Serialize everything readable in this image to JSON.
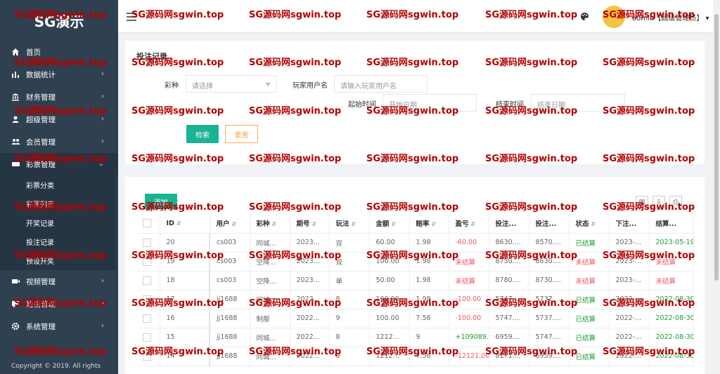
{
  "app": {
    "title": "SG演示"
  },
  "sidebar": {
    "items": [
      {
        "label": "首页",
        "icon": "home-icon"
      },
      {
        "label": "数据统计",
        "icon": "bar-chart-icon"
      },
      {
        "label": "财务管理",
        "icon": "bank-icon"
      },
      {
        "label": "超级管理",
        "icon": "user-shield-icon"
      },
      {
        "label": "会员管理",
        "icon": "users-icon"
      },
      {
        "label": "彩票管理",
        "icon": "lottery-icon"
      }
    ],
    "sub_items": [
      "彩票分类",
      "彩票列表",
      "开奖记录",
      "投注记录",
      "预设开奖"
    ],
    "items_after": [
      {
        "label": "视频管理",
        "icon": "video-icon"
      },
      {
        "label": "短信管理",
        "icon": "message-icon"
      },
      {
        "label": "系统管理",
        "icon": "gear-icon"
      }
    ],
    "copyright": "Copyright © 2019. All rights"
  },
  "header": {
    "user": "admin【超级管理员】"
  },
  "search": {
    "title": "投注记录",
    "lottery_label": "彩种",
    "lottery_placeholder": "请选择",
    "username_label": "玩家用户名",
    "username_placeholder": "请输入玩家用户名",
    "start_label": "起始时间",
    "start_placeholder": "开始日期",
    "end_label": "结束时间",
    "end_placeholder": "结束日期",
    "search_button": "检索",
    "reset_button": "重置"
  },
  "table": {
    "add_button": "添加",
    "columns": [
      "",
      "ID",
      "用户",
      "彩种",
      "期号",
      "玩法",
      "金额",
      "赔率",
      "盈亏",
      "投注...",
      "投注...",
      "状态",
      "下注...",
      "结算..."
    ],
    "rows": [
      {
        "id": "20",
        "user": "cs003",
        "lottery": "同城...",
        "issue": "2023...",
        "play": "双",
        "amount": "60.00",
        "odds": "1.98",
        "profit": "-60.00",
        "profit_color": "red",
        "b1": "8630....",
        "b2": "8570....",
        "status": "已结算",
        "status_color": "green",
        "bet_time": "2023-...",
        "settle_time": "2023-05-19",
        "settle_color": "green"
      },
      {
        "id": "19",
        "user": "cs003",
        "lottery": "空降...",
        "issue": "2023...",
        "play": "双",
        "amount": "100.00",
        "odds": "1.98",
        "profit": "未结算",
        "profit_color": "red",
        "b1": "8730....",
        "b2": "8630....",
        "status": "未结算",
        "status_color": "red",
        "bet_time": "2023-...",
        "settle_time": "未结算",
        "settle_color": "red"
      },
      {
        "id": "18",
        "user": "cs003",
        "lottery": "空降...",
        "issue": "2023...",
        "play": "单",
        "amount": "50.00",
        "odds": "1.98",
        "profit": "未结算",
        "profit_color": "red",
        "b1": "8780....",
        "b2": "8730....",
        "status": "未结算",
        "status_color": "red",
        "bet_time": "2023-...",
        "settle_time": "未结算",
        "settle_color": "red"
      },
      {
        "id": "17",
        "user": "jj1688",
        "lottery": "同城...",
        "issue": "2022...",
        "play": "8",
        "amount": "100.00",
        "odds": "1.98",
        "profit": "-100.00",
        "profit_color": "red",
        "b1": "5747....",
        "b2": "5737....",
        "status": "已结算",
        "status_color": "green",
        "bet_time": "2022-...",
        "settle_time": "2022-08-30",
        "settle_color": "green"
      },
      {
        "id": "16",
        "user": "jj1688",
        "lottery": "制服",
        "issue": "2022...",
        "play": "9",
        "amount": "100.00",
        "odds": "7.56",
        "profit": "-100.00",
        "profit_color": "red",
        "b1": "5747....",
        "b2": "5737....",
        "status": "已结算",
        "status_color": "green",
        "bet_time": "2022-...",
        "settle_time": "2022-08-30",
        "settle_color": "green"
      },
      {
        "id": "15",
        "user": "jj1688",
        "lottery": "同城...",
        "issue": "2022...",
        "play": "8",
        "amount": "1212...",
        "odds": "9",
        "profit": "+109089.0",
        "profit_color": "green",
        "b1": "6959....",
        "b2": "5747....",
        "status": "已结算",
        "status_color": "green",
        "bet_time": "2022-...",
        "settle_time": "2022-08-30",
        "settle_color": "green"
      },
      {
        "id": "14",
        "user": "jj1688",
        "lottery": "同城...",
        "issue": "2022...",
        "play": "9",
        "amount": "1212...",
        "odds": "7.56",
        "profit": "-12121.00",
        "profit_color": "red",
        "b1": "8171....",
        "b2": "6959....",
        "status": "已结算",
        "status_color": "green",
        "bet_time": "2022-...",
        "settle_time": "2022-08-30",
        "settle_color": "green"
      }
    ]
  },
  "watermark": "SG源码网sgwin.top",
  "colors": {
    "sidebar": "#2f4050",
    "primary": "#1ab394",
    "warning": "#f8ac59",
    "danger": "#ed5565",
    "success": "#1a9e35",
    "watermark": "#b40000"
  }
}
